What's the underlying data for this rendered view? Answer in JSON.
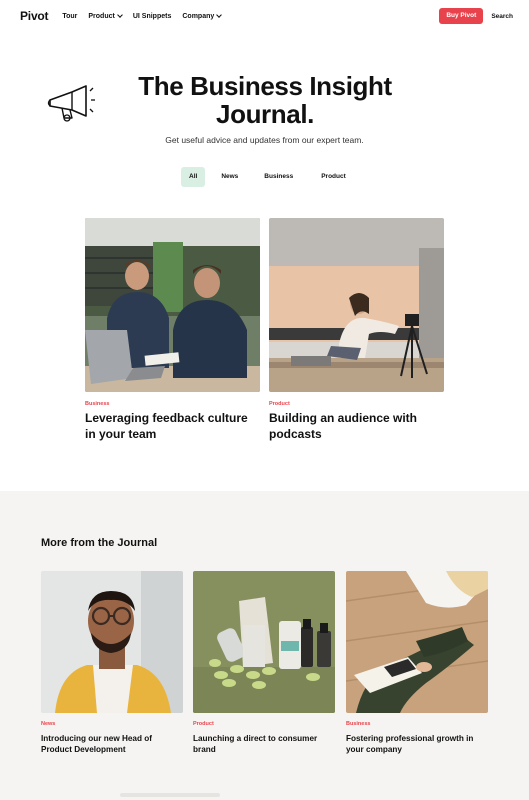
{
  "nav": {
    "logo": "Pivot",
    "links": [
      "Tour",
      "Product",
      "UI Snippets",
      "Company"
    ],
    "buy_label": "Buy Pivot",
    "search_label": "Search"
  },
  "hero": {
    "title": "The Business Insight Journal.",
    "subtitle": "Get useful advice and updates from our expert team."
  },
  "filters": [
    "All",
    "News",
    "Business",
    "Product"
  ],
  "featured": [
    {
      "category": "Business",
      "title": "Leveraging feedback culture in your team"
    },
    {
      "category": "Product",
      "title": "Building an audience with podcasts"
    }
  ],
  "more": {
    "heading": "More from the Journal",
    "cards": [
      {
        "category": "News",
        "title": "Introducing our new Head of Product Development"
      },
      {
        "category": "Product",
        "title": "Launching a direct to consumer brand"
      },
      {
        "category": "Business",
        "title": "Fostering professional growth in your company"
      }
    ]
  },
  "colors": {
    "accent": "#e8434c",
    "filter_active": "#d9efe4",
    "lower_bg": "#f5f4f2"
  }
}
